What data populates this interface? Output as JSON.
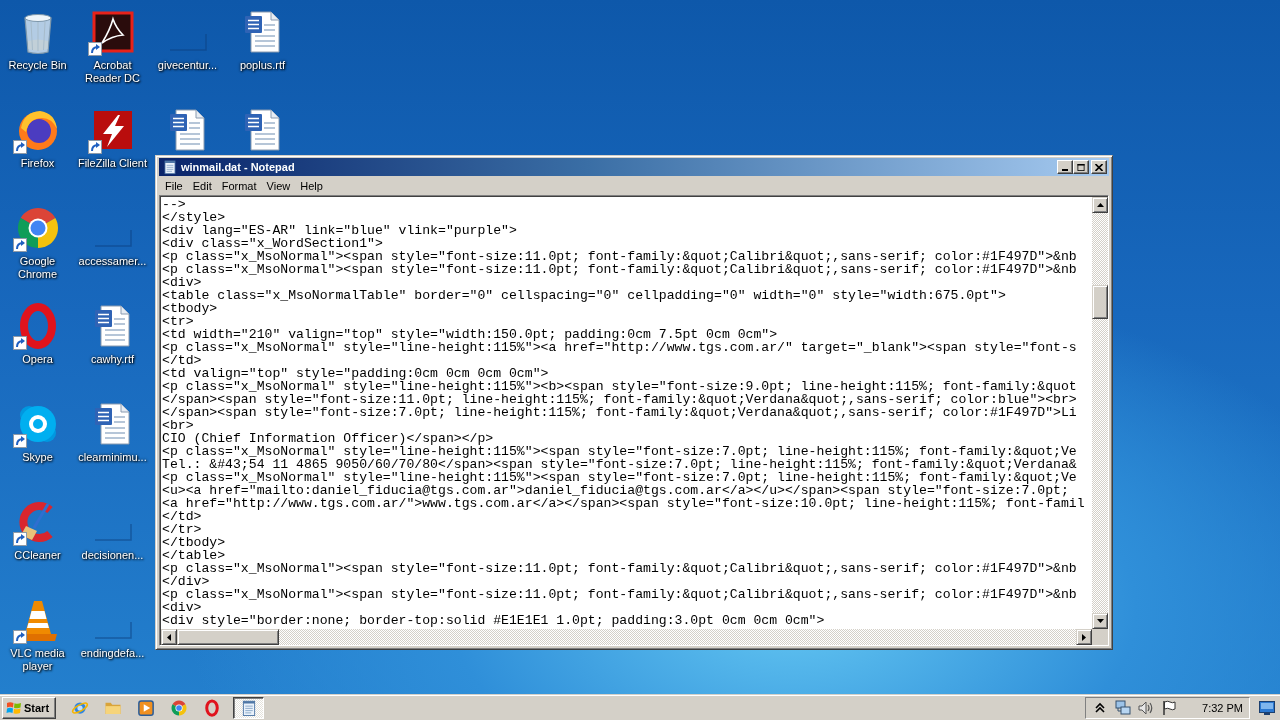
{
  "desktop": {
    "columns": [
      {
        "icons": [
          {
            "label": "Recycle Bin",
            "kind": "recycle-bin",
            "shortcut": false
          },
          {
            "label": "Firefox",
            "kind": "firefox",
            "shortcut": true
          },
          {
            "label": "Google Chrome",
            "kind": "chrome",
            "shortcut": true
          },
          {
            "label": "Opera",
            "kind": "opera",
            "shortcut": true
          },
          {
            "label": "Skype",
            "kind": "skype",
            "shortcut": true
          },
          {
            "label": "CCleaner",
            "kind": "ccleaner",
            "shortcut": true
          },
          {
            "label": "VLC media player",
            "kind": "vlc",
            "shortcut": true
          }
        ]
      },
      {
        "icons": [
          {
            "label": "Acrobat Reader DC",
            "kind": "acrobat",
            "shortcut": true
          },
          {
            "label": "FileZilla Client",
            "kind": "filezilla",
            "shortcut": true
          },
          {
            "label": "accessamer...",
            "kind": "blank",
            "shortcut": false
          },
          {
            "label": "cawhy.rtf",
            "kind": "word",
            "shortcut": false
          },
          {
            "label": "clearminimu...",
            "kind": "word",
            "shortcut": false
          },
          {
            "label": "decisionen...",
            "kind": "blank",
            "shortcut": false
          },
          {
            "label": "endingdefa...",
            "kind": "blank",
            "shortcut": false
          }
        ]
      },
      {
        "icons": [
          {
            "label": "givecentur...",
            "kind": "blank",
            "shortcut": false
          },
          {
            "kind": "word",
            "shortcut": false
          }
        ]
      },
      {
        "icons": [
          {
            "label": "poplus.rtf",
            "kind": "word",
            "shortcut": false
          },
          {
            "kind": "word",
            "shortcut": false
          }
        ]
      }
    ]
  },
  "notepad": {
    "title": "winmail.dat - Notepad",
    "menu": [
      "File",
      "Edit",
      "Format",
      "View",
      "Help"
    ],
    "lines": [
      "-->",
      "</style>",
      "<div lang=\"ES-AR\" link=\"blue\" vlink=\"purple\">",
      "<div class=\"x_WordSection1\">",
      "<p class=\"x_MsoNormal\"><span style=\"font-size:11.0pt; font-family:&quot;Calibri&quot;,sans-serif; color:#1F497D\">&nb",
      "<p class=\"x_MsoNormal\"><span style=\"font-size:11.0pt; font-family:&quot;Calibri&quot;,sans-serif; color:#1F497D\">&nb",
      "<div>",
      "<table class=\"x_MsoNormalTable\" border=\"0\" cellspacing=\"0\" cellpadding=\"0\" width=\"0\" style=\"width:675.0pt\">",
      "<tbody>",
      "<tr>",
      "<td width=\"210\" valign=\"top\" style=\"width:150.0pt; padding:0cm 7.5pt 0cm 0cm\">",
      "<p class=\"x_MsoNormal\" style=\"line-height:115%\"><a href=\"http://www.tgs.com.ar/\" target=\"_blank\"><span style=\"font-s",
      "</td>",
      "<td valign=\"top\" style=\"padding:0cm 0cm 0cm 0cm\">",
      "<p class=\"x_MsoNormal\" style=\"line-height:115%\"><b><span style=\"font-size:9.0pt; line-height:115%; font-family:&quot",
      "</span><span style=\"font-size:11.0pt; line-height:115%; font-family:&quot;Verdana&quot;,sans-serif; color:blue\"><br>",
      "</span><span style=\"font-size:7.0pt; line-height:115%; font-family:&quot;Verdana&quot;,sans-serif; color:#1F497D\">Li",
      "<br>",
      "CIO (Chief Information Officer)</span></p>",
      "<p class=\"x_MsoNormal\" style=\"line-height:115%\"><span style=\"font-size:7.0pt; line-height:115%; font-family:&quot;Ve",
      "Tel.: &#43;54 11 4865 9050/60/70/80</span><span style=\"font-size:7.0pt; line-height:115%; font-family:&quot;Verdana&",
      "<p class=\"x_MsoNormal\" style=\"line-height:115%\"><span style=\"font-size:7.0pt; line-height:115%; font-family:&quot;Ve",
      "<u><a href=\"mailto:daniel_fiducia@tgs.com.ar\">daniel_fiducia@tgs.com.ar</a></u></span><span style=\"font-size:7.0pt;",
      "<a href=\"http://www.tgs.com.ar/\">www.tgs.com.ar</a></span><span style=\"font-size:10.0pt; line-height:115%; font-famil",
      "</td>",
      "</tr>",
      "</tbody>",
      "</table>",
      "<p class=\"x_MsoNormal\"><span style=\"font-size:11.0pt; font-family:&quot;Calibri&quot;,sans-serif; color:#1F497D\">&nb",
      "</div>",
      "<p class=\"x_MsoNormal\"><span style=\"font-size:11.0pt; font-family:&quot;Calibri&quot;,sans-serif; color:#1F497D\">&nb",
      "<div>",
      "<div style=\"border:none; border-top:solid #E1E1E1 1.0pt; padding:3.0pt 0cm 0cm 0cm\">"
    ]
  },
  "taskbar": {
    "start": "Start",
    "pinned": [
      {
        "kind": "ie"
      },
      {
        "kind": "explorer"
      },
      {
        "kind": "media-player"
      },
      {
        "kind": "chrome"
      },
      {
        "kind": "opera"
      }
    ],
    "tasks": [
      {
        "kind": "notepad",
        "selected": true
      }
    ],
    "tray": [
      {
        "kind": "chevron"
      },
      {
        "kind": "network"
      },
      {
        "kind": "volume"
      },
      {
        "kind": "flag"
      }
    ],
    "clock": "7:32 PM"
  }
}
